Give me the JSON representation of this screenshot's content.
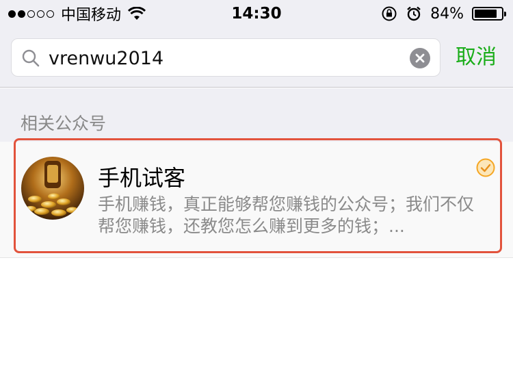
{
  "status_bar": {
    "carrier": "中国移动",
    "time": "14:30",
    "battery_percent": "84%",
    "battery_level": 0.84,
    "signal_bars_filled": 2,
    "signal_bars_total": 5
  },
  "search": {
    "query": "vrenwu2014",
    "cancel_label": "取消"
  },
  "section": {
    "title": "相关公众号"
  },
  "result": {
    "name": "手机试客",
    "description": "手机赚钱，真正能够帮您赚钱的公众号；我们不仅帮您赚钱，还教您怎么赚到更多的钱；...",
    "verified": true
  },
  "colors": {
    "accent_green": "#1aad19",
    "highlight_red": "#e2533c",
    "verified_orange": "#f5a623"
  }
}
